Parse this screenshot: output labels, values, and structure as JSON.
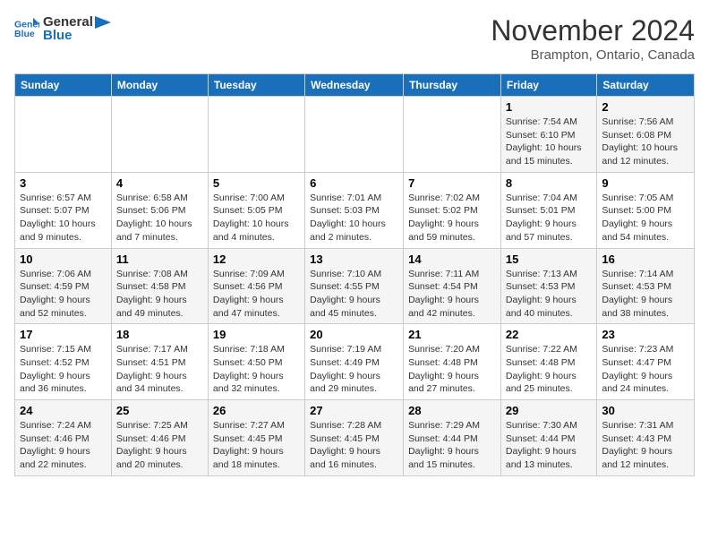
{
  "logo": {
    "line1": "General",
    "line2": "Blue"
  },
  "title": "November 2024",
  "location": "Brampton, Ontario, Canada",
  "days_of_week": [
    "Sunday",
    "Monday",
    "Tuesday",
    "Wednesday",
    "Thursday",
    "Friday",
    "Saturday"
  ],
  "weeks": [
    [
      {
        "day": "",
        "info": ""
      },
      {
        "day": "",
        "info": ""
      },
      {
        "day": "",
        "info": ""
      },
      {
        "day": "",
        "info": ""
      },
      {
        "day": "",
        "info": ""
      },
      {
        "day": "1",
        "info": "Sunrise: 7:54 AM\nSunset: 6:10 PM\nDaylight: 10 hours and 15 minutes."
      },
      {
        "day": "2",
        "info": "Sunrise: 7:56 AM\nSunset: 6:08 PM\nDaylight: 10 hours and 12 minutes."
      }
    ],
    [
      {
        "day": "3",
        "info": "Sunrise: 6:57 AM\nSunset: 5:07 PM\nDaylight: 10 hours and 9 minutes."
      },
      {
        "day": "4",
        "info": "Sunrise: 6:58 AM\nSunset: 5:06 PM\nDaylight: 10 hours and 7 minutes."
      },
      {
        "day": "5",
        "info": "Sunrise: 7:00 AM\nSunset: 5:05 PM\nDaylight: 10 hours and 4 minutes."
      },
      {
        "day": "6",
        "info": "Sunrise: 7:01 AM\nSunset: 5:03 PM\nDaylight: 10 hours and 2 minutes."
      },
      {
        "day": "7",
        "info": "Sunrise: 7:02 AM\nSunset: 5:02 PM\nDaylight: 9 hours and 59 minutes."
      },
      {
        "day": "8",
        "info": "Sunrise: 7:04 AM\nSunset: 5:01 PM\nDaylight: 9 hours and 57 minutes."
      },
      {
        "day": "9",
        "info": "Sunrise: 7:05 AM\nSunset: 5:00 PM\nDaylight: 9 hours and 54 minutes."
      }
    ],
    [
      {
        "day": "10",
        "info": "Sunrise: 7:06 AM\nSunset: 4:59 PM\nDaylight: 9 hours and 52 minutes."
      },
      {
        "day": "11",
        "info": "Sunrise: 7:08 AM\nSunset: 4:58 PM\nDaylight: 9 hours and 49 minutes."
      },
      {
        "day": "12",
        "info": "Sunrise: 7:09 AM\nSunset: 4:56 PM\nDaylight: 9 hours and 47 minutes."
      },
      {
        "day": "13",
        "info": "Sunrise: 7:10 AM\nSunset: 4:55 PM\nDaylight: 9 hours and 45 minutes."
      },
      {
        "day": "14",
        "info": "Sunrise: 7:11 AM\nSunset: 4:54 PM\nDaylight: 9 hours and 42 minutes."
      },
      {
        "day": "15",
        "info": "Sunrise: 7:13 AM\nSunset: 4:53 PM\nDaylight: 9 hours and 40 minutes."
      },
      {
        "day": "16",
        "info": "Sunrise: 7:14 AM\nSunset: 4:53 PM\nDaylight: 9 hours and 38 minutes."
      }
    ],
    [
      {
        "day": "17",
        "info": "Sunrise: 7:15 AM\nSunset: 4:52 PM\nDaylight: 9 hours and 36 minutes."
      },
      {
        "day": "18",
        "info": "Sunrise: 7:17 AM\nSunset: 4:51 PM\nDaylight: 9 hours and 34 minutes."
      },
      {
        "day": "19",
        "info": "Sunrise: 7:18 AM\nSunset: 4:50 PM\nDaylight: 9 hours and 32 minutes."
      },
      {
        "day": "20",
        "info": "Sunrise: 7:19 AM\nSunset: 4:49 PM\nDaylight: 9 hours and 29 minutes."
      },
      {
        "day": "21",
        "info": "Sunrise: 7:20 AM\nSunset: 4:48 PM\nDaylight: 9 hours and 27 minutes."
      },
      {
        "day": "22",
        "info": "Sunrise: 7:22 AM\nSunset: 4:48 PM\nDaylight: 9 hours and 25 minutes."
      },
      {
        "day": "23",
        "info": "Sunrise: 7:23 AM\nSunset: 4:47 PM\nDaylight: 9 hours and 24 minutes."
      }
    ],
    [
      {
        "day": "24",
        "info": "Sunrise: 7:24 AM\nSunset: 4:46 PM\nDaylight: 9 hours and 22 minutes."
      },
      {
        "day": "25",
        "info": "Sunrise: 7:25 AM\nSunset: 4:46 PM\nDaylight: 9 hours and 20 minutes."
      },
      {
        "day": "26",
        "info": "Sunrise: 7:27 AM\nSunset: 4:45 PM\nDaylight: 9 hours and 18 minutes."
      },
      {
        "day": "27",
        "info": "Sunrise: 7:28 AM\nSunset: 4:45 PM\nDaylight: 9 hours and 16 minutes."
      },
      {
        "day": "28",
        "info": "Sunrise: 7:29 AM\nSunset: 4:44 PM\nDaylight: 9 hours and 15 minutes."
      },
      {
        "day": "29",
        "info": "Sunrise: 7:30 AM\nSunset: 4:44 PM\nDaylight: 9 hours and 13 minutes."
      },
      {
        "day": "30",
        "info": "Sunrise: 7:31 AM\nSunset: 4:43 PM\nDaylight: 9 hours and 12 minutes."
      }
    ]
  ]
}
